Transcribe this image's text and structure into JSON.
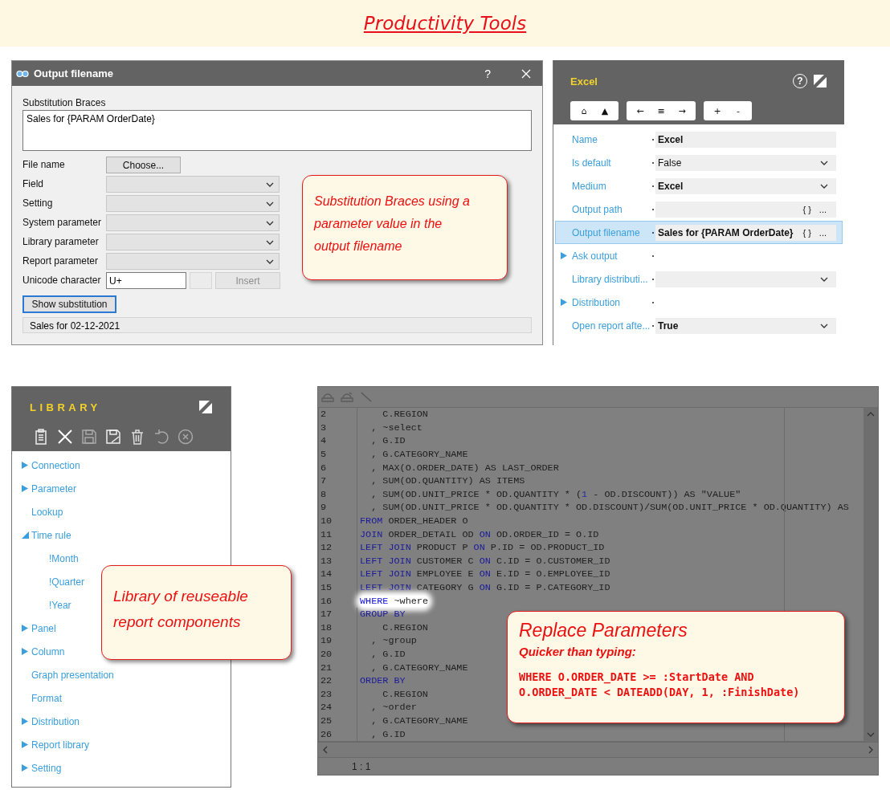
{
  "title": "Productivity Tools",
  "dialog": {
    "title": "Output filename",
    "help": "?",
    "braces_label": "Substitution Braces",
    "braces_value": "Sales for {PARAM OrderDate}",
    "rows": [
      {
        "label": "File name",
        "kind": "button",
        "button": "Choose..."
      },
      {
        "label": "Field",
        "kind": "dropdown",
        "disabled": true
      },
      {
        "label": "Setting",
        "kind": "dropdown",
        "disabled": true
      },
      {
        "label": "System parameter",
        "kind": "dropdown",
        "disabled": true
      },
      {
        "label": "Library parameter",
        "kind": "dropdown",
        "disabled": true
      },
      {
        "label": "Report parameter",
        "kind": "dropdown",
        "disabled": true
      },
      {
        "label": "Unicode character",
        "kind": "unicode",
        "value": "U+",
        "button": "Insert",
        "disabled": true
      }
    ],
    "show_button": "Show substitution",
    "show_focused": true,
    "result": "Sales for 02-12-2021"
  },
  "dialog_callout": "Substitution Braces using a parameter value in the output filename",
  "properties": {
    "title": "Excel",
    "help": "?",
    "toolbar": [
      [
        "⌂",
        "▲"
      ],
      [
        "←",
        "≡",
        "→"
      ],
      [
        "+",
        "-"
      ]
    ],
    "rows": [
      {
        "label": "Name",
        "kind": "text",
        "value": "Excel",
        "bold": true,
        "selected": false
      },
      {
        "label": "Is default",
        "kind": "dropdown",
        "value": "False",
        "bold": false,
        "selected": false
      },
      {
        "label": "Medium",
        "kind": "dropdown",
        "value": "Excel",
        "bold": true,
        "selected": false
      },
      {
        "label": "Output path",
        "kind": "path",
        "buttons": [
          "{ }",
          "..."
        ],
        "selected": false
      },
      {
        "label": "Output filename",
        "kind": "path",
        "value": "Sales for {PARAM OrderDate}",
        "bold": true,
        "buttons": [
          "{ }",
          "..."
        ],
        "selected": true
      },
      {
        "label": "Ask output",
        "kind": "group",
        "selected": false
      },
      {
        "label": "Library distributi...",
        "kind": "dropdown",
        "selected": false
      },
      {
        "label": "Distribution",
        "kind": "group",
        "selected": false
      },
      {
        "label": "Open report afte...",
        "kind": "dropdown",
        "value": "True",
        "bold": true,
        "selected": false
      }
    ]
  },
  "library": {
    "title": "LIBRARY",
    "toolbar": [
      {
        "kind": "clipboard",
        "disabled": false
      },
      {
        "kind": "close",
        "disabled": false
      },
      {
        "kind": "save",
        "disabled": true
      },
      {
        "kind": "save-as",
        "disabled": false
      },
      {
        "kind": "trash",
        "disabled": false
      },
      {
        "kind": "undo",
        "disabled": true
      },
      {
        "kind": "cancel",
        "disabled": true
      }
    ],
    "tree": [
      {
        "label": "Connection",
        "kind": "branch",
        "expanded": false
      },
      {
        "label": "Parameter",
        "kind": "branch",
        "expanded": false
      },
      {
        "label": "Lookup",
        "kind": "leaf"
      },
      {
        "label": "Time rule",
        "kind": "branch",
        "expanded": true,
        "children": [
          {
            "label": "!Month"
          },
          {
            "label": "!Quarter"
          },
          {
            "label": "!Year"
          }
        ]
      },
      {
        "label": "Panel",
        "kind": "branch",
        "expanded": false
      },
      {
        "label": "Column",
        "kind": "branch",
        "expanded": false
      },
      {
        "label": "Graph presentation",
        "kind": "leaf"
      },
      {
        "label": "Format",
        "kind": "leaf"
      },
      {
        "label": "Distribution",
        "kind": "branch",
        "expanded": false
      },
      {
        "label": "Report library",
        "kind": "branch",
        "expanded": false
      },
      {
        "label": "Setting",
        "kind": "branch",
        "expanded": false
      }
    ]
  },
  "library_callout": "Library of reuseable report components",
  "editor": {
    "cursor": "1 : 1",
    "lines": [
      {
        "number": "2",
        "highlighted": false,
        "segments": [
          {
            "kind": "plain",
            "text": "    C.REGION"
          }
        ]
      },
      {
        "number": "3",
        "highlighted": false,
        "segments": [
          {
            "kind": "plain",
            "text": "  , ~select"
          }
        ]
      },
      {
        "number": "4",
        "highlighted": false,
        "segments": [
          {
            "kind": "plain",
            "text": "  , G.ID"
          }
        ]
      },
      {
        "number": "5",
        "highlighted": false,
        "segments": [
          {
            "kind": "plain",
            "text": "  , G.CATEGORY_NAME"
          }
        ]
      },
      {
        "number": "6",
        "highlighted": false,
        "segments": [
          {
            "kind": "plain",
            "text": "  , MAX(O.ORDER_DATE) AS LAST_ORDER"
          }
        ]
      },
      {
        "number": "7",
        "highlighted": false,
        "segments": [
          {
            "kind": "plain",
            "text": "  , SUM(OD.QUANTITY) AS ITEMS"
          }
        ]
      },
      {
        "number": "8",
        "highlighted": false,
        "segments": [
          {
            "kind": "plain",
            "text": "  , SUM(OD.UNIT_PRICE * OD.QUANTITY * ("
          },
          {
            "kind": "number",
            "text": "1"
          },
          {
            "kind": "plain",
            "text": " - OD.DISCOUNT)) AS \"VALUE\""
          }
        ]
      },
      {
        "number": "9",
        "highlighted": false,
        "segments": [
          {
            "kind": "plain",
            "text": "  , SUM(OD.UNIT_PRICE * OD.QUANTITY * OD.DISCOUNT)/SUM(OD.UNIT_PRICE * OD.QUANTITY) AS"
          }
        ]
      },
      {
        "number": "10",
        "highlighted": false,
        "segments": [
          {
            "kind": "keyword",
            "text": "FROM"
          },
          {
            "kind": "plain",
            "text": " ORDER_HEADER O"
          }
        ]
      },
      {
        "number": "11",
        "highlighted": false,
        "segments": [
          {
            "kind": "keyword",
            "text": "JOIN"
          },
          {
            "kind": "plain",
            "text": " ORDER_DETAIL OD "
          },
          {
            "kind": "keyword",
            "text": "ON"
          },
          {
            "kind": "plain",
            "text": " OD.ORDER_ID = O.ID"
          }
        ]
      },
      {
        "number": "12",
        "highlighted": false,
        "segments": [
          {
            "kind": "keyword",
            "text": "LEFT JOIN"
          },
          {
            "kind": "plain",
            "text": " PRODUCT P "
          },
          {
            "kind": "keyword",
            "text": "ON"
          },
          {
            "kind": "plain",
            "text": " P.ID = OD.PRODUCT_ID"
          }
        ]
      },
      {
        "number": "13",
        "highlighted": false,
        "segments": [
          {
            "kind": "keyword",
            "text": "LEFT JOIN"
          },
          {
            "kind": "plain",
            "text": " CUSTOMER C "
          },
          {
            "kind": "keyword",
            "text": "ON"
          },
          {
            "kind": "plain",
            "text": " C.ID = O.CUSTOMER_ID"
          }
        ]
      },
      {
        "number": "14",
        "highlighted": false,
        "segments": [
          {
            "kind": "keyword",
            "text": "LEFT JOIN"
          },
          {
            "kind": "plain",
            "text": " EMPLOYEE E "
          },
          {
            "kind": "keyword",
            "text": "ON"
          },
          {
            "kind": "plain",
            "text": " E.ID = O.EMPLOYEE_ID"
          }
        ]
      },
      {
        "number": "15",
        "highlighted": false,
        "segments": [
          {
            "kind": "keyword",
            "text": "LEFT JOIN"
          },
          {
            "kind": "plain",
            "text": " CATEGORY G "
          },
          {
            "kind": "keyword",
            "text": "ON"
          },
          {
            "kind": "plain",
            "text": " G.ID = P.CATEGORY_ID"
          }
        ]
      },
      {
        "number": "16",
        "highlighted": true,
        "segments": [
          {
            "kind": "keyword",
            "text": "WHERE"
          },
          {
            "kind": "plain",
            "text": " ~where"
          }
        ]
      },
      {
        "number": "17",
        "highlighted": false,
        "segments": [
          {
            "kind": "keyword",
            "text": "GROUP BY"
          }
        ]
      },
      {
        "number": "18",
        "highlighted": false,
        "segments": [
          {
            "kind": "plain",
            "text": "    C.REGION"
          }
        ]
      },
      {
        "number": "19",
        "highlighted": false,
        "segments": [
          {
            "kind": "plain",
            "text": "  , ~group"
          }
        ]
      },
      {
        "number": "20",
        "highlighted": false,
        "segments": [
          {
            "kind": "plain",
            "text": "  , G.ID"
          }
        ]
      },
      {
        "number": "21",
        "highlighted": false,
        "segments": [
          {
            "kind": "plain",
            "text": "  , G.CATEGORY_NAME"
          }
        ]
      },
      {
        "number": "22",
        "highlighted": false,
        "segments": [
          {
            "kind": "keyword",
            "text": "ORDER BY"
          }
        ]
      },
      {
        "number": "23",
        "highlighted": false,
        "segments": [
          {
            "kind": "plain",
            "text": "    C.REGION"
          }
        ]
      },
      {
        "number": "24",
        "highlighted": false,
        "segments": [
          {
            "kind": "plain",
            "text": "  , ~order"
          }
        ]
      },
      {
        "number": "25",
        "highlighted": false,
        "segments": [
          {
            "kind": "plain",
            "text": "  , G.CATEGORY_NAME"
          }
        ]
      },
      {
        "number": "26",
        "highlighted": false,
        "segments": [
          {
            "kind": "plain",
            "text": "  , G.ID"
          }
        ]
      }
    ]
  },
  "editor_callout": {
    "title": "Replace Parameters",
    "subtitle": "Quicker than typing:",
    "code": [
      "WHERE O.ORDER_DATE >= :StartDate AND",
      "O.ORDER_DATE < DATEADD(DAY, 1, :FinishDate)"
    ]
  }
}
